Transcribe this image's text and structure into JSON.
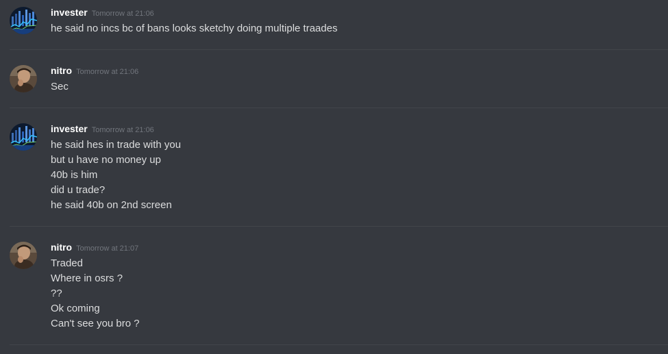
{
  "messages": [
    {
      "author": "invester",
      "timestamp": "Tomorrow at 21:06",
      "avatar": "chart-avatar",
      "lines": [
        "he said no incs bc of bans looks sketchy doing multiple traades"
      ]
    },
    {
      "author": "nitro",
      "timestamp": "Tomorrow at 21:06",
      "avatar": "person-avatar",
      "lines": [
        "Sec"
      ]
    },
    {
      "author": "invester",
      "timestamp": "Tomorrow at 21:06",
      "avatar": "chart-avatar",
      "lines": [
        "he said hes in trade with you",
        "but u have no money up",
        "40b is him",
        "did u trade?",
        "he said 40b on 2nd screen"
      ]
    },
    {
      "author": "nitro",
      "timestamp": "Tomorrow at 21:07",
      "avatar": "person-avatar",
      "lines": [
        "Traded",
        "Where in osrs ?",
        "??",
        "Ok coming",
        "Can't see you bro ?"
      ]
    }
  ],
  "colors": {
    "background": "#36393f",
    "username": "#ffffff",
    "timestamp": "#72767d",
    "text": "#dcddde",
    "divider": "#42454a"
  }
}
